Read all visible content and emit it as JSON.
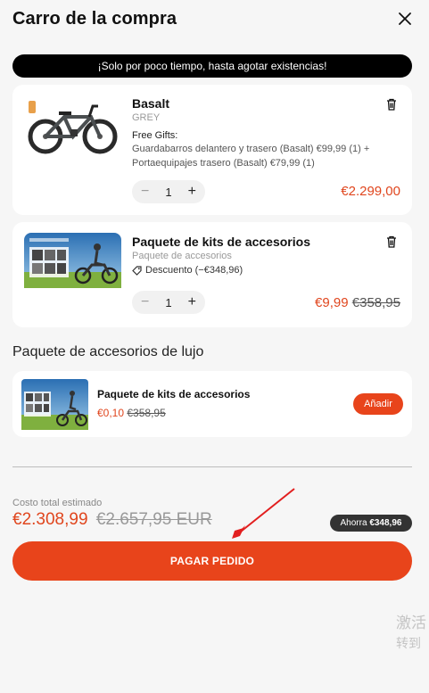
{
  "header": {
    "title": "Carro de la compra",
    "close_icon": "close-icon"
  },
  "promo": {
    "text": "¡Solo por poco tiempo, hasta agotar existencias!"
  },
  "cart_items": [
    {
      "name": "Basalt",
      "variant": "GREY",
      "gifts_title": "Free Gifts:",
      "gifts_desc": "Guardabarros delantero y trasero (Basalt) €99,99 (1) + Portaequipajes trasero (Basalt) €79,99 (1)",
      "quantity": "1",
      "price": "€2.299,00"
    },
    {
      "name": "Paquete de kits de accesorios",
      "variant": "Paquete de accesorios",
      "discount": "Descuento (−€348,96)",
      "quantity": "1",
      "price": "€9,99",
      "old_price": "€358,95"
    }
  ],
  "upsell": {
    "section_title": "Paquete de accesorios de lujo",
    "name": "Paquete de kits de accesorios",
    "price": "€0,10",
    "old_price": "€358,95",
    "add_label": "Añadir"
  },
  "summary": {
    "label": "Costo total estimado",
    "total": "€2.308,99",
    "old_total": "€2.657,95 EUR",
    "save_prefix": "Ahorra",
    "save_amount": "€348,96",
    "pay_label": "PAGAR PEDIDO"
  },
  "watermark": {
    "line1": "激活",
    "line2": "转到"
  },
  "colors": {
    "accent": "#e8441b",
    "price": "#e0461e",
    "background": "#f6f6f6",
    "promo_bg": "#000000"
  }
}
